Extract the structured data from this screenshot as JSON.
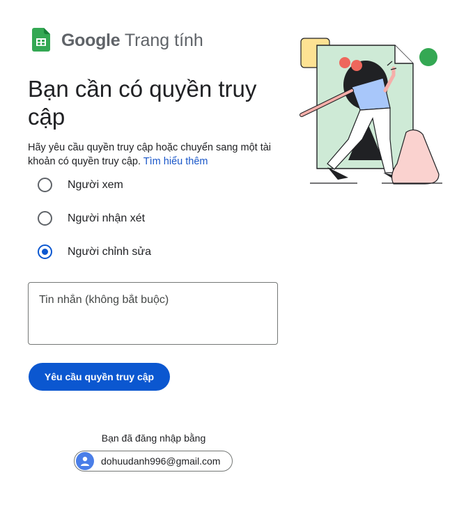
{
  "brand": {
    "logo_word": "Google",
    "product": "Trang tính"
  },
  "title": "Bạn cần có quyền truy cập",
  "description": {
    "text": "Hãy yêu cầu quyền truy cập hoặc chuyển sang một tài khoản có quyền truy cập. ",
    "link": "Tìm hiểu thêm"
  },
  "roles": [
    {
      "label": "Người xem",
      "selected": false
    },
    {
      "label": "Người nhận xét",
      "selected": false
    },
    {
      "label": "Người chỉnh sửa",
      "selected": true
    }
  ],
  "message": {
    "placeholder": "Tin nhắn (không bắt buộc)",
    "value": ""
  },
  "request_button": "Yêu cầu quyền truy cập",
  "signed_in": {
    "label": "Bạn đã đăng nhập bằng",
    "email": "dohuudanh996@gmail.com"
  },
  "colors": {
    "accent": "#0b57d0",
    "sheets_green": "#34a853",
    "link": "#1a57c9"
  }
}
